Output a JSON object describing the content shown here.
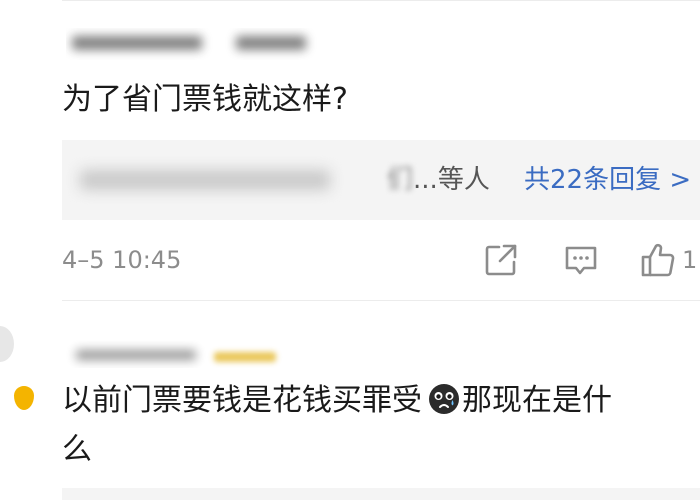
{
  "comment_1": {
    "text": "为了省门票钱就这样?",
    "replies_tail": "等人",
    "replies_ellipsis": "...",
    "replies_fade": "们",
    "replies_link": "共22条回复 >",
    "timestamp": "4–5 10:45",
    "like_count": "1",
    "icons": {
      "share": "share-icon",
      "comment": "comment-icon",
      "like": "thumbs-up-icon"
    }
  },
  "comment_2": {
    "text_before_emoji": "以前门票要钱是花钱买罪受",
    "emoji": "crying-face-emoji",
    "text_after_emoji": "那现在是什",
    "text_line2": "么"
  },
  "colors": {
    "link": "#3b6cc2",
    "meta_gray": "#8c8c8c",
    "reply_box_bg": "#f4f4f4"
  }
}
